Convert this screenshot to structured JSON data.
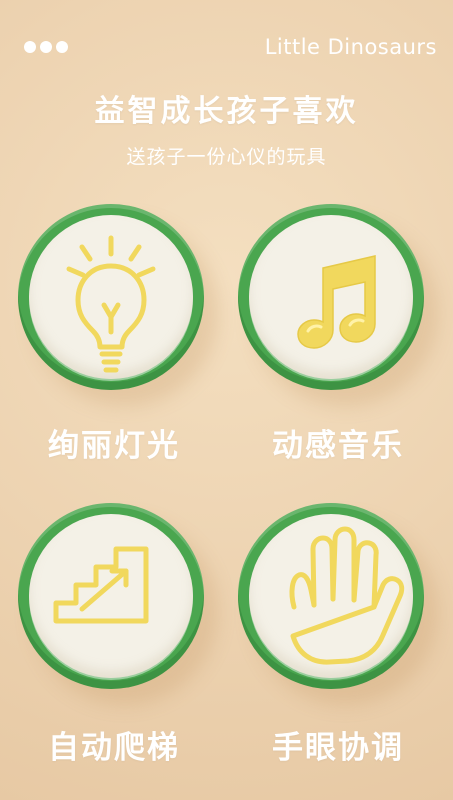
{
  "header": {
    "brand": "Little Dinosaurs",
    "menu_icon": "menu-dots-icon"
  },
  "hero": {
    "title": "益智成长孩子喜欢",
    "subtitle": "送孩子一份心仪的玩具"
  },
  "features": [
    {
      "label": "绚丽灯光",
      "icon": "lightbulb-icon"
    },
    {
      "label": "动感音乐",
      "icon": "music-note-icon"
    },
    {
      "label": "自动爬梯",
      "icon": "stairs-icon"
    },
    {
      "label": "手眼协调",
      "icon": "hand-icon"
    }
  ],
  "colors": {
    "background": "#edd3b1",
    "ring": "#4aa64f",
    "button_face": "#f4f1e7",
    "icon": "#f1d85d",
    "text": "#ffffff"
  }
}
